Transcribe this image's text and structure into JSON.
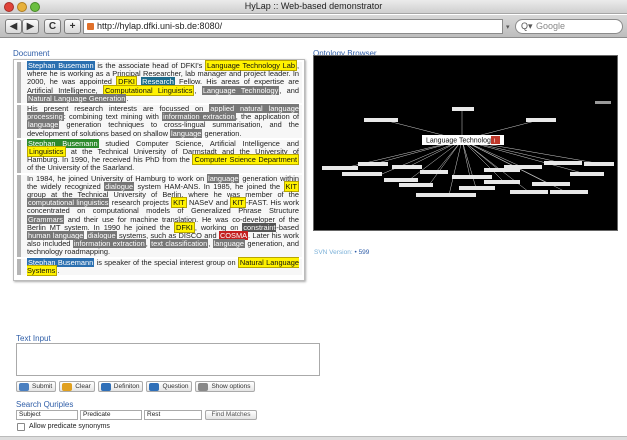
{
  "window": {
    "title": "HyLap :: Web-based demonstrator"
  },
  "toolbar": {
    "back": "◀",
    "forward": "▶",
    "reload": "C",
    "add": "+",
    "url": "http://hylap.dfki.uni-sb.de:8080/",
    "search_placeholder": "Google"
  },
  "document": {
    "heading": "Document",
    "paragraphs": [
      [
        {
          "t": "Stephan Busemann",
          "c": "blue"
        },
        {
          "t": " is the associate head of DFKI's "
        },
        {
          "t": "Language Technology Lab",
          "c": "yel"
        },
        {
          "t": ", where he is working as a Principal Researcher, lab manager and project leader. In 2000, he was appointed "
        },
        {
          "t": "DFKI",
          "c": "yel"
        },
        {
          "t": " "
        },
        {
          "t": "Research",
          "c": "teal"
        },
        {
          "t": " Fellow. His areas of expertise are Artificial Intelligence, "
        },
        {
          "t": "Computational Linguistics",
          "c": "yel"
        },
        {
          "t": ", "
        },
        {
          "t": "Language Technology",
          "c": "grey"
        },
        {
          "t": ", and "
        },
        {
          "t": "Natural Language Generation",
          "c": "grey"
        },
        {
          "t": "."
        }
      ],
      [
        {
          "t": "His present research interests are focussed on "
        },
        {
          "t": "applied natural language processing",
          "c": "grey"
        },
        {
          "t": ": combining text mining with "
        },
        {
          "t": "information extraction",
          "c": "grey"
        },
        {
          "t": ", the application of "
        },
        {
          "t": "language",
          "c": "grey"
        },
        {
          "t": " generation techniques to cross-lingual summarisation, and the development of solutions based on shallow "
        },
        {
          "t": "language",
          "c": "grey"
        },
        {
          "t": " generation."
        }
      ],
      [
        {
          "t": "Stephan Busemann",
          "c": "green"
        },
        {
          "t": " studied Computer Science, Artificial Intelligence and "
        },
        {
          "t": "Linguistics",
          "c": "yel"
        },
        {
          "t": " at the Technical University of Darmstadt and the University of Hamburg. In 1990, he received his PhD from the "
        },
        {
          "t": "Computer Science Department",
          "c": "yel"
        },
        {
          "t": " of the University of the Saarland."
        }
      ],
      [
        {
          "t": "In 1984, he joined University of Hamburg to work on "
        },
        {
          "t": "language",
          "c": "grey"
        },
        {
          "t": " generation within the widely recognized "
        },
        {
          "t": "dialogue",
          "c": "grey"
        },
        {
          "t": " system HAM-ANS. In 1985, he joined the "
        },
        {
          "t": "KIT",
          "c": "yel"
        },
        {
          "t": " group at the Technical University of Berlin, where he was member of the "
        },
        {
          "t": "computational linguistics",
          "c": "grey"
        },
        {
          "t": " research projects "
        },
        {
          "t": "KIT",
          "c": "yel"
        },
        {
          "t": " NASeV and "
        },
        {
          "t": "KIT",
          "c": "yel"
        },
        {
          "t": "-FAST. His work concentrated on computational models of Generalized Phrase Structure "
        },
        {
          "t": "Grammars",
          "c": "grey"
        },
        {
          "t": " and their use for machine translation. He was co-developer of the Berlin MT system. In 1990 he joined the "
        },
        {
          "t": "DFKI",
          "c": "yel"
        },
        {
          "t": ", working on "
        },
        {
          "t": "constraint",
          "c": "dgrey"
        },
        {
          "t": "-based "
        },
        {
          "t": "human language",
          "c": "grey"
        },
        {
          "t": " "
        },
        {
          "t": "dialogue",
          "c": "grey"
        },
        {
          "t": " systems, such as DISCO and "
        },
        {
          "t": "COSMA",
          "c": "red"
        },
        {
          "t": ". Later his work also included "
        },
        {
          "t": "information extraction",
          "c": "grey"
        },
        {
          "t": ", "
        },
        {
          "t": "text classification",
          "c": "grey"
        },
        {
          "t": ", "
        },
        {
          "t": "language",
          "c": "grey"
        },
        {
          "t": " generation, and technology roadmapping."
        }
      ],
      [
        {
          "t": "Stephan Busemann",
          "c": "blue"
        },
        {
          "t": " is speaker of the special interest group on "
        },
        {
          "t": "Natural Language Systems",
          "c": "yel"
        },
        {
          "t": "."
        }
      ]
    ]
  },
  "ontology": {
    "heading": "Ontology Browser",
    "center": "Language Technology",
    "center_badge": "i"
  },
  "svn": {
    "label": "SVN Version:",
    "value": "• 599"
  },
  "text_input": {
    "heading": "Text Input",
    "value": ""
  },
  "actions": [
    {
      "label": "Submit",
      "icon": "submit-icon",
      "color": "#4a7fc0"
    },
    {
      "label": "Clear",
      "icon": "clear-icon",
      "color": "#e0a020"
    },
    {
      "label": "Definiton",
      "icon": "definition-icon",
      "color": "#2f6fb8"
    },
    {
      "label": "Question",
      "icon": "question-icon",
      "color": "#2f6fb8"
    },
    {
      "label": "Show options",
      "icon": "options-icon",
      "color": "#888"
    }
  ],
  "quiples": {
    "heading": "Search Quriples",
    "subject": "Subject",
    "predicate": "Predicate",
    "rest": "Rest",
    "find": "Find Matches",
    "synonyms_label": "Allow predicate synonyms"
  }
}
